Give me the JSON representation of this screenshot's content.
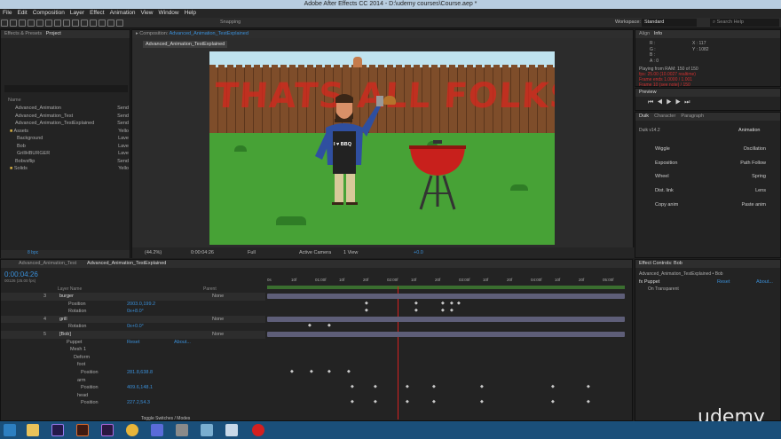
{
  "window": {
    "title": "Adobe After Effects CC 2014 - D:\\udemy courses\\Course.aep *"
  },
  "menu": [
    "File",
    "Edit",
    "Composition",
    "Layer",
    "Effect",
    "Animation",
    "View",
    "Window",
    "Help"
  ],
  "toolbar": {
    "snapping": "Snapping",
    "workspace_label": "Workspace:",
    "workspace_value": "Standard",
    "search_placeholder": "Search Help"
  },
  "left_panel": {
    "tabs": [
      "Effects & Presets",
      "Project"
    ],
    "col_name": "Name",
    "items": [
      {
        "name": "Advanced_Animation",
        "type": "Send"
      },
      {
        "name": "Advanced_Animation_Test",
        "type": "Send"
      },
      {
        "name": "Advanced_Animation_TestExplained",
        "type": "Send"
      },
      {
        "name": "Assets",
        "type": "Yello"
      },
      {
        "name": "Background",
        "type": "Lave"
      },
      {
        "name": "Bob",
        "type": "Lave"
      },
      {
        "name": "GrillHBURGER",
        "type": "Lave"
      },
      {
        "name": "Bobvsflip",
        "type": "Send"
      },
      {
        "name": "Solids",
        "type": "Yello"
      }
    ],
    "bpc": "8 bpc"
  },
  "comp": {
    "tab_label": "Composition",
    "comp_name": "Advanced_Animation_TestExplained",
    "sub_tab": "Advanced_Animation_TestExplained",
    "zoom": "(44.2%)",
    "time": "0:00:04:26",
    "res": "Full",
    "camera": "Active Camera",
    "views": "1 View",
    "exposure": "+0.0",
    "graffiti": "THATS ALL FOLKS",
    "apron": "I ♥ BBQ"
  },
  "info": {
    "tabs": [
      "Align",
      "Info"
    ],
    "r": "R :",
    "g": "G :",
    "b": "B :",
    "a": "A : 0",
    "x": "X : 117",
    "y": "Y : 1082",
    "playing": "Playing from RAM: 150 of 150",
    "fps": "fps: 25.00 (10.0027 realtime)",
    "skip": "Frame ends 1.0000 / 1.001",
    "note": "Frame 10 (see note) / 150"
  },
  "preview": {
    "tab": "Preview"
  },
  "duik": {
    "tabs": [
      "Duik",
      "Character",
      "Paragraph"
    ],
    "version": "Duik v14.2",
    "mode": "Animation",
    "tools": [
      "Wiggle",
      "Oscillation",
      "Exposition",
      "Path Follow",
      "Wheel",
      "Spring",
      "Dist. link",
      "Lens",
      "Copy anim",
      "Paste anim"
    ]
  },
  "timeline": {
    "tabs": [
      "Advanced_Animation_Test",
      "Advanced_Animation_TestExplained"
    ],
    "timecode": "0:00:04:26",
    "fps_small": "00126 (25.00 fps)",
    "col_layer": "Layer Name",
    "col_parent": "Parent",
    "toggle": "Toggle Switches / Modes",
    "layers": [
      {
        "num": "3",
        "name": "burger",
        "parent": "None"
      },
      {
        "num": "",
        "name": "Position",
        "value": "2003.0,199.2"
      },
      {
        "num": "",
        "name": "Rotation",
        "value": "0x+8.0°"
      },
      {
        "num": "4",
        "name": "grill",
        "parent": "None"
      },
      {
        "num": "",
        "name": "Rotation",
        "value": "0x+0.0°"
      },
      {
        "num": "5",
        "name": "[Bob]",
        "parent": "None"
      },
      {
        "num": "",
        "name": "Puppet",
        "value": "Reset",
        "extra": "About..."
      },
      {
        "num": "",
        "name": "Mesh 1"
      },
      {
        "num": "",
        "name": "Deform"
      },
      {
        "num": "",
        "name": "foot"
      },
      {
        "num": "",
        "name": "Position",
        "value": "281.8,638.8"
      },
      {
        "num": "",
        "name": "arm"
      },
      {
        "num": "",
        "name": "Position",
        "value": "409.6,148.1"
      },
      {
        "num": "",
        "name": "head"
      },
      {
        "num": "",
        "name": "Position",
        "value": "227.2,54.3"
      }
    ],
    "ruler": [
      "0s",
      "10f",
      "01:00f",
      "10f",
      "20f",
      "02:00f",
      "10f",
      "20f",
      "03:00f",
      "10f",
      "20f",
      "04:00f",
      "10f",
      "20f",
      "05:00f"
    ]
  },
  "effect_controls": {
    "tab": "Effect Controls: Bob",
    "layer": "Advanced_Animation_TestExplained • Bob",
    "fx": "Puppet",
    "reset": "Reset",
    "about": "About...",
    "on_transparent": "On Transparent"
  },
  "watermark": "udemy"
}
